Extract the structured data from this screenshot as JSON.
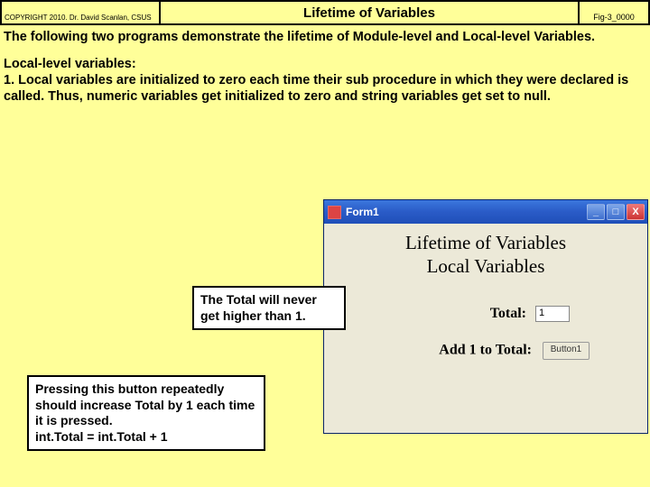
{
  "header": {
    "copyright": "COPYRIGHT 2010. Dr. David Scanlan, CSUS",
    "title": "Lifetime of Variables",
    "ref": "Fig-3_0000"
  },
  "intro": "The following two programs demonstrate the lifetime of Module-level and Local-level Variables.",
  "section": {
    "heading": "Local-level variables:",
    "body": "1. Local variables are initialized to zero each time their sub procedure in which they were declared is called.  Thus, numeric variables get initialized to zero and string variables get set to null."
  },
  "form": {
    "window_title": "Form1",
    "heading_line1": "Lifetime of Variables",
    "heading_line2": "Local Variables",
    "total_label": "Total:",
    "total_value": "1",
    "button_label_prefix": "Add 1 to Total:",
    "button_text": "Button1"
  },
  "callouts": {
    "c1": "The Total  will never get higher than 1.",
    "c2_l1": "Pressing this button repeatedly should increase Total by 1 each time it is pressed.",
    "c2_l2": "int.Total = int.Total + 1"
  }
}
